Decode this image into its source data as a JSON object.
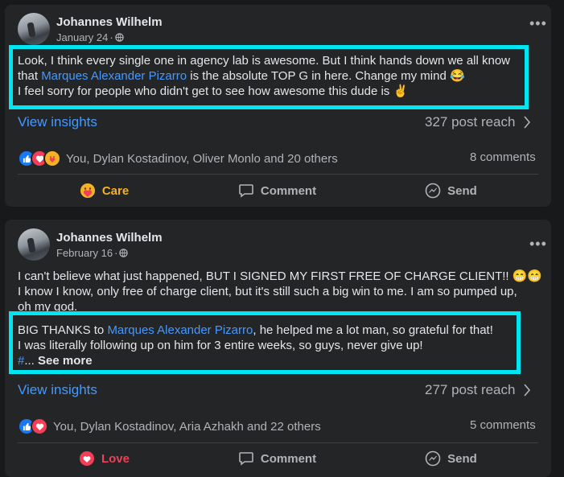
{
  "posts": [
    {
      "author": "Johannes Wilhelm",
      "date": "January 24",
      "date_sep": " · ",
      "lines": [
        [
          "Look, I think every single one in agency lab is awesome. But I think hands down we all know"
        ],
        [
          "that ",
          "Marques Alexander Pizarro",
          " is the absolute TOP G in here. Change my mind 😂"
        ],
        [
          "I feel sorry for people who didn't get to see how awesome this dude is ✌️"
        ]
      ],
      "view_insights": "View insights",
      "post_reach": "327 post reach",
      "reactions_text": "You, Dylan Kostadinov, Oliver Monlo and 20 others",
      "comments": "8 comments",
      "action_reaction": "Care",
      "action_comment": "Comment",
      "action_send": "Send"
    },
    {
      "author": "Johannes Wilhelm",
      "date": "February 16",
      "date_sep": " · ",
      "lines": [
        [
          "I can't believe what just happened, BUT I SIGNED MY FIRST FREE OF CHARGE CLIENT!! 😁😁"
        ],
        [
          "I know I know, only free of charge client, but it's still such a big win to me. I am so pumped up,"
        ],
        [
          "oh my god."
        ],
        [
          "BIG THANKS to ",
          "Marques Alexander Pizarro",
          ", he helped me a lot man, so grateful for that!"
        ],
        [
          "I was literally following up on him for 3 entire weeks, so guys, never give up!"
        ],
        [
          "#",
          "... ",
          "See more"
        ]
      ],
      "view_insights": "View insights",
      "post_reach": "277 post reach",
      "reactions_text": "You, Dylan Kostadinov, Aria Azhakh and 22 others",
      "comments": "5 comments",
      "action_reaction": "Love",
      "action_comment": "Comment",
      "action_send": "Send"
    }
  ],
  "colors": {
    "background": "#18191a",
    "card": "#242526",
    "link": "#4599ff",
    "highlight_box": "#00e5f2",
    "care": "#f7b125",
    "love": "#f33e58"
  },
  "icons": [
    "globe-icon",
    "more-options-icon",
    "chevron-right-icon",
    "like-reaction-icon",
    "love-reaction-icon",
    "care-reaction-icon",
    "comment-icon",
    "send-icon"
  ]
}
